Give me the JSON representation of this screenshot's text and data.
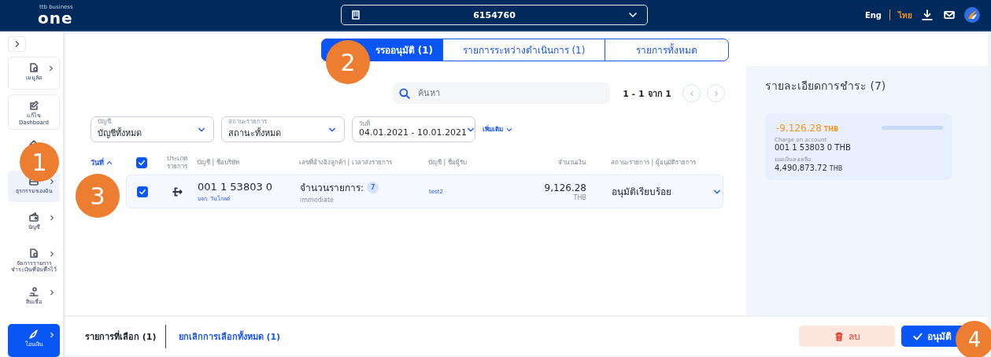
{
  "header": {
    "logo_small": "ttb business",
    "logo": "one",
    "account": "6154760",
    "languages": [
      {
        "label": "Eng",
        "selected": false
      },
      {
        "label": "ไทย",
        "selected": true
      }
    ]
  },
  "sidebar": {
    "items": [
      {
        "label": "เมนูลัด",
        "kind": "card",
        "expandable": true,
        "selected": false
      },
      {
        "label": "แก้ไข Dashboard",
        "kind": "card",
        "expandable": false,
        "selected": false
      },
      {
        "kind": "plain",
        "expandable": false,
        "selected": false
      },
      {
        "label": "ธุรกรรมของฉัน",
        "kind": "plain",
        "expandable": true,
        "selected": true
      },
      {
        "label": "บัญชี",
        "kind": "plain",
        "expandable": true,
        "selected": false
      },
      {
        "label": "จัดการรายการชำระเงินที่บันทึกไว้",
        "kind": "plain",
        "expandable": true,
        "selected": false
      },
      {
        "label": "สินเชื่อ",
        "kind": "plain",
        "expandable": true,
        "selected": false
      },
      {
        "label": "โอนเงิน",
        "kind": "primary",
        "expandable": true,
        "selected": false
      }
    ]
  },
  "tabs": [
    {
      "label": "รรออนุมัติ (1)",
      "selected": true
    },
    {
      "label": "รายการระหว่างดำเนินการ (1)",
      "selected": false
    },
    {
      "label": "รายการทั้งหมด",
      "selected": false
    }
  ],
  "search": {
    "placeholder": "ค้นหา"
  },
  "pagination": "1 - 1 จาก 1",
  "filters": [
    {
      "label": "บัญชี",
      "value": "บัญชีทั้งหมด"
    },
    {
      "label": "สถานะรายการ",
      "value": "สถานะทั้งหมด"
    },
    {
      "label": "วันที่",
      "value": "04.01.2021 - 10.01.2021"
    }
  ],
  "more_filters": "เพิ่มเติม",
  "table": {
    "sort_column": "วันที่",
    "select_all_checked": true,
    "columns": [
      "ประเภท รายการ",
      "บัญชี | ชื่อบริษัท",
      "เลขที่อ้างอิงลูกค้า | เวลาส่งรายการ",
      "บัญชี | ชื่อผู้รับ",
      "จำนวนเงิน",
      "สถานะรายการ | ผู้อนุมัติรายการ"
    ],
    "rows": [
      {
        "checked": true,
        "account": "001 1 53803 0",
        "company": "บจก. วันโกลด์",
        "count_label": "จำนวนรายการ:",
        "count": "7",
        "timing": "immediate",
        "payee": "test2",
        "amount": "9,126.28",
        "currency": "THB",
        "status": "อนุมัติเรียบร้อย"
      }
    ]
  },
  "details": {
    "title": "รายละเอียดการชำระ (7)",
    "amount": "-9,126.28",
    "amount_currency": "THB",
    "account_label": "Charge on account",
    "account": "001 1 53803 0 THB",
    "balance_label": "ยอดเงินคงเหลือ",
    "balance": "4,490,873.72",
    "balance_currency": "THB"
  },
  "footer": {
    "selected": "รายการที่เลือก (1)",
    "clear": "ยกเลิกการเลือกทั้งหมด (1)",
    "delete": "ลบ",
    "approve": "อนุมัติ"
  },
  "callouts": [
    "1",
    "2",
    "3",
    "4"
  ]
}
